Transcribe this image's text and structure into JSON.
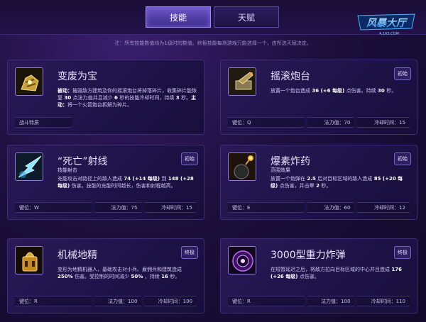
{
  "tabs": {
    "skills": "技能",
    "talents": "天赋"
  },
  "logo": {
    "text": "风暴大厅",
    "sub": "A.163.COM"
  },
  "note": "注：所有技能数值均为1级时的数值。终极技能每场游戏只能选择一个，由所选天赋决定。",
  "cards": [
    {
      "title": "变废为宝",
      "badge": "",
      "d_pre": "被动：",
      "d1": "摧毁敌方建筑及你的摇滚炮台将掉落碎片，收集碎片能恢复",
      "d_n1": " 30 ",
      "d2": "点法力值并且减少",
      "d_n2": " 6 ",
      "d3": "秒的技能冷却时间，持续",
      "d_n3": " 3 ",
      "d4": "秒。",
      "d_pre2": "主动：",
      "d5": "将一个火箭炮台拆解为碎片。",
      "trait": "战斗特质",
      "icon": "scrap-icon"
    },
    {
      "title": "摇滚炮台",
      "badge": "初始",
      "d1": "放置一个炮台造成",
      "d_n1": " 36 (+6 每级) ",
      "d2": "点伤害。持续",
      "d_n2": " 30 ",
      "d3": "秒。",
      "key": "键位：Q",
      "mana": "法力值：70",
      "cd": "冷却时间：15",
      "icon": "turret-icon"
    },
    {
      "title": "“死亡”射线",
      "subtitle": "技能射击",
      "badge": "初始",
      "d1": "充能攻击对路径上的敌人造成",
      "d_n1": " 74 (+14 每级) ",
      "d2": "到",
      "d_n2": " 148 (+28 每级) ",
      "d3": "伤害。技能的充能时间越长，伤害和射程越高。",
      "key": "键位：W",
      "mana": "法力值：75",
      "cd": "冷却时间：15",
      "icon": "death-ray-icon"
    },
    {
      "title": "爆素炸药",
      "subtitle": "范围效果",
      "badge": "初始",
      "d1": "放置一个炮弹在",
      "d_n1": " 2.5 ",
      "d2": "后对目标区域的敌人造成",
      "d_n2": " 85 (+20 每级) ",
      "d3": "点伤害，并击晕",
      "d_n3": " 2 ",
      "d4": "秒。",
      "key": "键位：E",
      "mana": "法力值：60",
      "cd": "冷却时间：12",
      "icon": "bomb-icon"
    },
    {
      "title": "机械地精",
      "badge": "终极",
      "d1": "变形为地精机器人，基础攻击对小兵、雇佣兵和建筑造成",
      "d_n1": " 250% ",
      "d2": "伤害。受控制的时间减少",
      "d_n2": " 50% ",
      "d3": "，持续",
      "d_n3": " 16 ",
      "d4": "秒。",
      "key": "键位：R",
      "mana": "法力值：100",
      "cd": "冷却时间：100",
      "icon": "robo-goblin-icon"
    },
    {
      "title": "3000型重力炸弹",
      "badge": "终极",
      "d1": "在短暂延迟之后，将敌方拉向目标区域的中心并且造成",
      "d_n1": " 176 (+26 每级) ",
      "d2": "点伤害。",
      "key": "键位：R",
      "mana": "法力值：100",
      "cd": "冷却时间：110",
      "icon": "gravity-bomb-icon"
    }
  ]
}
